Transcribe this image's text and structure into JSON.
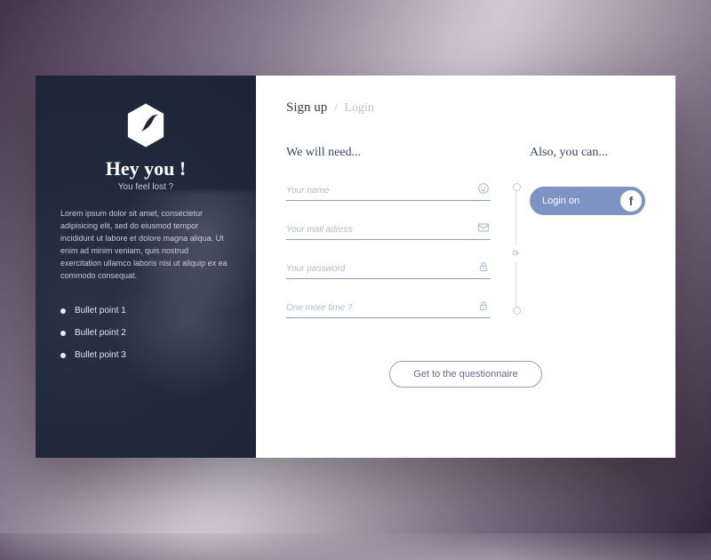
{
  "hero": {
    "title": "Hey you !",
    "subtitle": "You feel lost ?",
    "body": "Lorem ipsum dolor sit amet, consectetur adipisicing elit, sed do eiusmod tempor incididunt ut labore et dolore magna aliqua. Ut enim ad minim veniam, quis nostrud exercitation ullamco laboris nisi ut aliquip ex ea commodo consequat.",
    "bullets": [
      "Bullet point 1",
      "Bullet point 2",
      "Bullet point 3"
    ]
  },
  "tabs": {
    "active": "Sign up",
    "inactive": "Login",
    "separator": "/"
  },
  "form": {
    "heading": "We will need...",
    "fields": {
      "name": {
        "placeholder": "Your name"
      },
      "email": {
        "placeholder": "Your mail adress"
      },
      "password": {
        "placeholder": "Your password"
      },
      "password_confirm": {
        "placeholder": "One more time ?"
      }
    }
  },
  "social": {
    "heading": "Also, you can...",
    "or_label": "Or",
    "button_label": "Login on",
    "provider_initial": "f"
  },
  "cta": {
    "label": "Get to the questionnaire"
  },
  "colors": {
    "accent": "#7d93c4",
    "line": "#8da0c8"
  }
}
